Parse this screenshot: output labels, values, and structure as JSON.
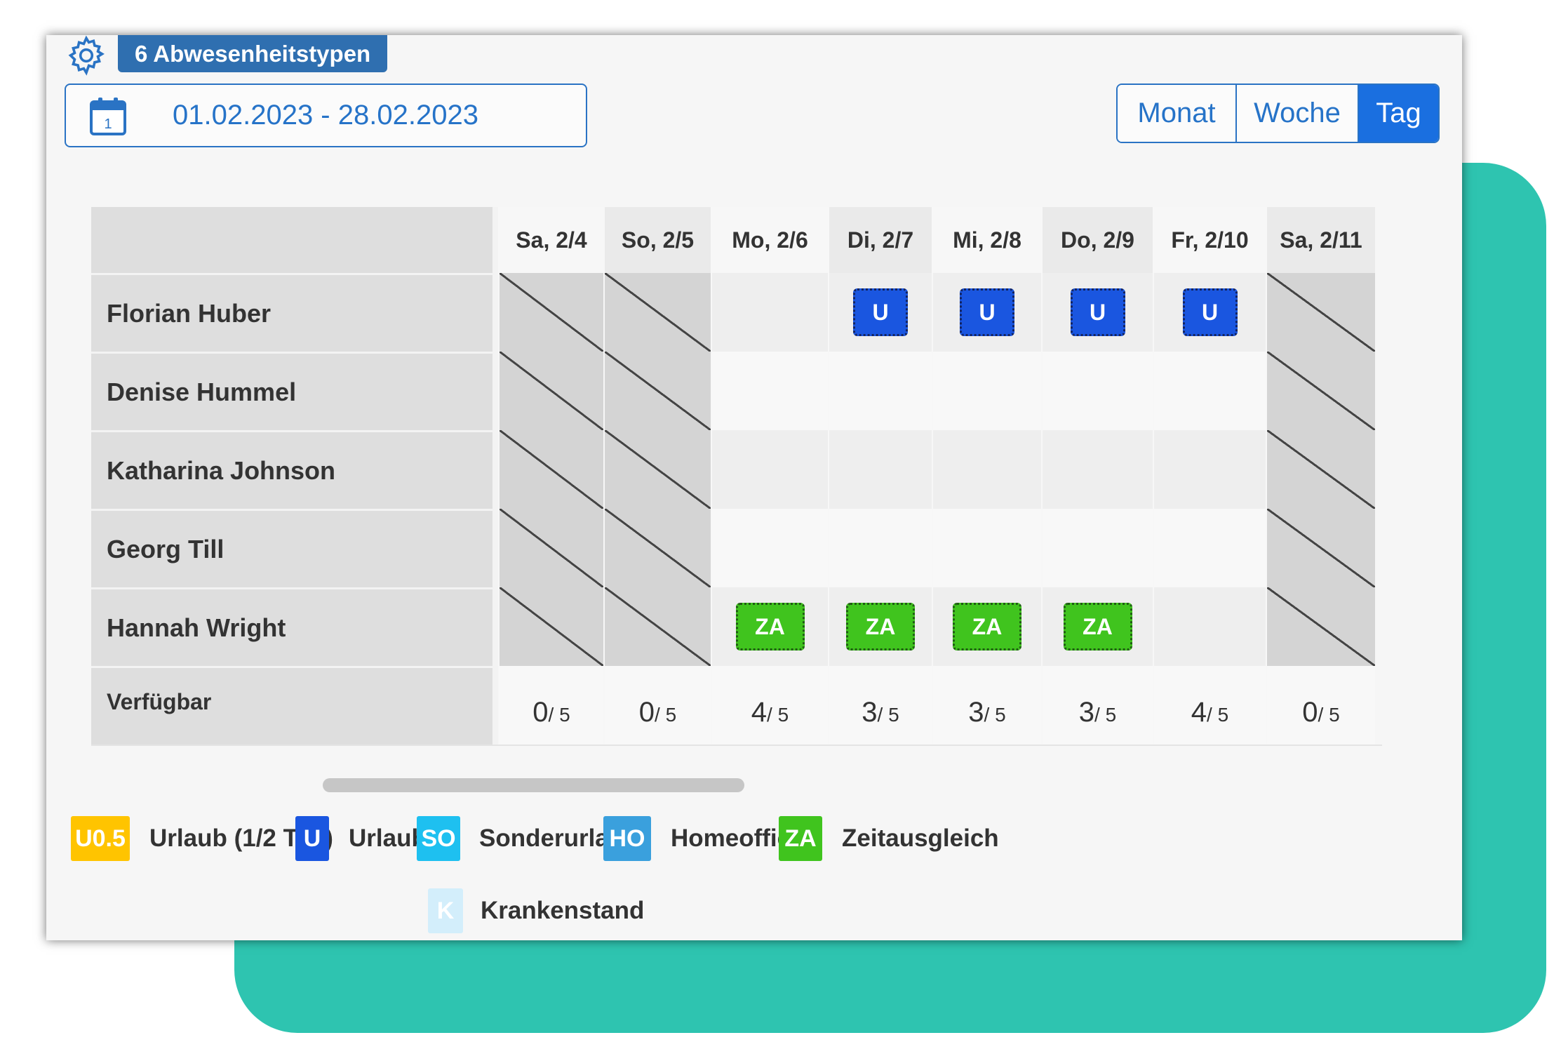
{
  "header": {
    "types_badge": "6 Abwesenheitstypen",
    "date_range": "01.02.2023 - 28.02.2023",
    "calendar_day": "1",
    "views": [
      "Monat",
      "Woche",
      "Tag"
    ],
    "active_view": "Tag"
  },
  "days": [
    "Sa, 2/4",
    "So, 2/5",
    "Mo, 2/6",
    "Di, 2/7",
    "Mi, 2/8",
    "Do, 2/9",
    "Fr, 2/10",
    "Sa, 2/11"
  ],
  "employees": [
    {
      "name": "Florian Huber",
      "entries": [
        "",
        "",
        "",
        "U",
        "U",
        "U",
        "U",
        ""
      ]
    },
    {
      "name": "Denise Hummel",
      "entries": [
        "",
        "",
        "",
        "",
        "",
        "",
        "",
        ""
      ]
    },
    {
      "name": "Katharina Johnson",
      "entries": [
        "",
        "",
        "",
        "",
        "",
        "",
        "",
        ""
      ]
    },
    {
      "name": "Georg Till",
      "entries": [
        "",
        "",
        "",
        "",
        "",
        "",
        "",
        ""
      ]
    },
    {
      "name": "Hannah Wright",
      "entries": [
        "",
        "",
        "ZA",
        "ZA",
        "ZA",
        "ZA",
        "",
        ""
      ]
    }
  ],
  "availability": {
    "label": "Verfügbar",
    "values": [
      {
        "num": "0",
        "den": "/ 5"
      },
      {
        "num": "0",
        "den": "/ 5"
      },
      {
        "num": "4",
        "den": "/ 5"
      },
      {
        "num": "3",
        "den": "/ 5"
      },
      {
        "num": "3",
        "den": "/ 5"
      },
      {
        "num": "3",
        "den": "/ 5"
      },
      {
        "num": "4",
        "den": "/ 5"
      },
      {
        "num": "0",
        "den": "/ 5"
      }
    ]
  },
  "legend": [
    {
      "code": "U0.5",
      "label": "Urlaub (1/2 Tag)",
      "color": "#ffc400"
    },
    {
      "code": "U",
      "label": "Urlaub",
      "color": "#1a56e0"
    },
    {
      "code": "SO",
      "label": "Sonderurlaub",
      "color": "#1ec0f0"
    },
    {
      "code": "HO",
      "label": "Homeoffice",
      "color": "#3aa0dd"
    },
    {
      "code": "ZA",
      "label": "Zeitausgleich",
      "color": "#40c41e"
    },
    {
      "code": "K",
      "label": "Krankenstand",
      "color": "#d3eefb"
    }
  ]
}
